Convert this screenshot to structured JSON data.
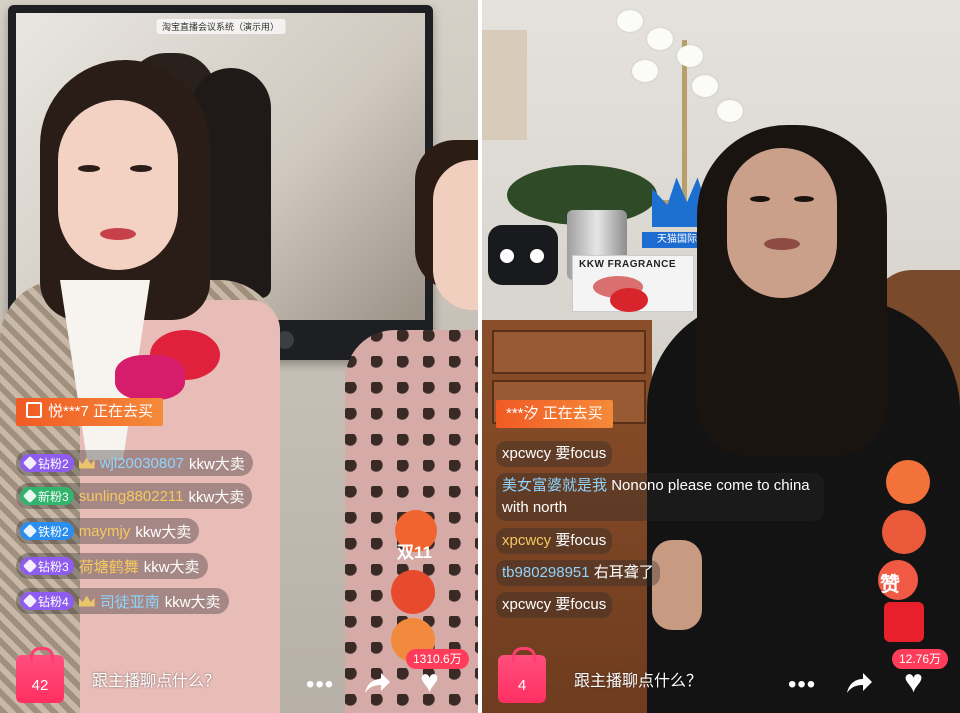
{
  "left": {
    "tv": {
      "title": "淘宝直播会议系统（演示用）"
    },
    "notice": "悦***7 正在去买",
    "comments": [
      {
        "badge": "钻粉2",
        "badge_color": "#8f5cf0",
        "crown": true,
        "user": "wjl20030807",
        "user_color": "#8fd4ff",
        "msg": "kkw大卖"
      },
      {
        "badge": "新粉3",
        "badge_color": "#31b46c",
        "crown": false,
        "user": "sunling8802211",
        "user_color": "#f6c85f",
        "msg": "kkw大卖"
      },
      {
        "badge": "铁粉2",
        "badge_color": "#2a8ef0",
        "crown": false,
        "user": "maymjy",
        "user_color": "#f6c85f",
        "msg": "kkw大卖"
      },
      {
        "badge": "钻粉3",
        "badge_color": "#8f5cf0",
        "crown": false,
        "user": "荷塘鹤舞",
        "user_color": "#f6c85f",
        "msg": "kkw大卖"
      },
      {
        "badge": "钻粉4",
        "badge_color": "#8f5cf0",
        "crown": true,
        "user": "司徒亚南",
        "user_color": "#8fd4ff",
        "msg": "kkw大卖"
      }
    ],
    "cart_count": "42",
    "chat_placeholder": "跟主播聊点什么？",
    "likes": "1310.6万",
    "sticker": "双11"
  },
  "right": {
    "notice": "***汐 正在去买",
    "brand_label": "天猫国际风赏",
    "kkw_label": "KKW FRAGRANCE",
    "comments": [
      {
        "user": "xpcwcy",
        "user_color": "#ffffff",
        "msg": "要focus"
      },
      {
        "user": "美女富婆就是我",
        "user_color": "#8fd4ff",
        "msg": "Nonono please come to china with north"
      },
      {
        "user": "xpcwcy",
        "user_color": "#f6c85f",
        "msg": "要focus"
      },
      {
        "user": "tb980298951",
        "user_color": "#8fd4ff",
        "msg": "右耳聋了"
      },
      {
        "user": "xpcwcy",
        "user_color": "#ffffff",
        "msg": "要focus"
      }
    ],
    "cart_count": "4",
    "chat_placeholder": "跟主播聊点什么？",
    "likes": "12.76万",
    "sticker": "赞"
  },
  "icons": {
    "more": "more-dots-icon",
    "share": "share-arrow-icon",
    "like": "heart-icon",
    "cart": "shopping-bag-icon"
  },
  "colors": {
    "accent": "#ff3d5b",
    "notice": "#f15a24"
  }
}
